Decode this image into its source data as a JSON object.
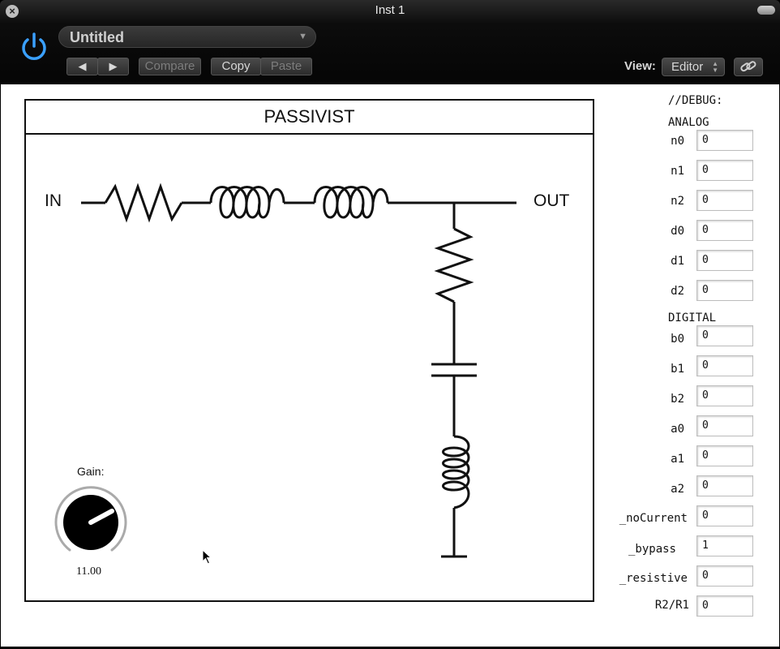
{
  "window": {
    "title": "Inst 1"
  },
  "header": {
    "preset_name": "Untitled",
    "compare_label": "Compare",
    "copy_label": "Copy",
    "paste_label": "Paste",
    "view_label": "View:",
    "view_value": "Editor"
  },
  "plugin": {
    "title": "PASSIVIST",
    "in_label": "IN",
    "out_label": "OUT",
    "gain": {
      "label": "Gain:",
      "value": "11.00"
    }
  },
  "debug": {
    "heading": "//DEBUG:",
    "analog_label": "ANALOG",
    "digital_label": "DIGITAL",
    "analog": [
      {
        "name": "n0",
        "value": "0"
      },
      {
        "name": "n1",
        "value": "0"
      },
      {
        "name": "n2",
        "value": "0"
      },
      {
        "name": "d0",
        "value": "0"
      },
      {
        "name": "d1",
        "value": "0"
      },
      {
        "name": "d2",
        "value": "0"
      }
    ],
    "digital": [
      {
        "name": "b0",
        "value": "0"
      },
      {
        "name": "b1",
        "value": "0"
      },
      {
        "name": "b2",
        "value": "0"
      },
      {
        "name": "a0",
        "value": "0"
      },
      {
        "name": "a1",
        "value": "0"
      },
      {
        "name": "a2",
        "value": "0"
      },
      {
        "name": "_noCurrent",
        "value": "0"
      },
      {
        "name": "_bypass",
        "value": "1"
      },
      {
        "name": "_resistive",
        "value": "0"
      },
      {
        "name": "R2/R1",
        "value": "0"
      }
    ]
  }
}
